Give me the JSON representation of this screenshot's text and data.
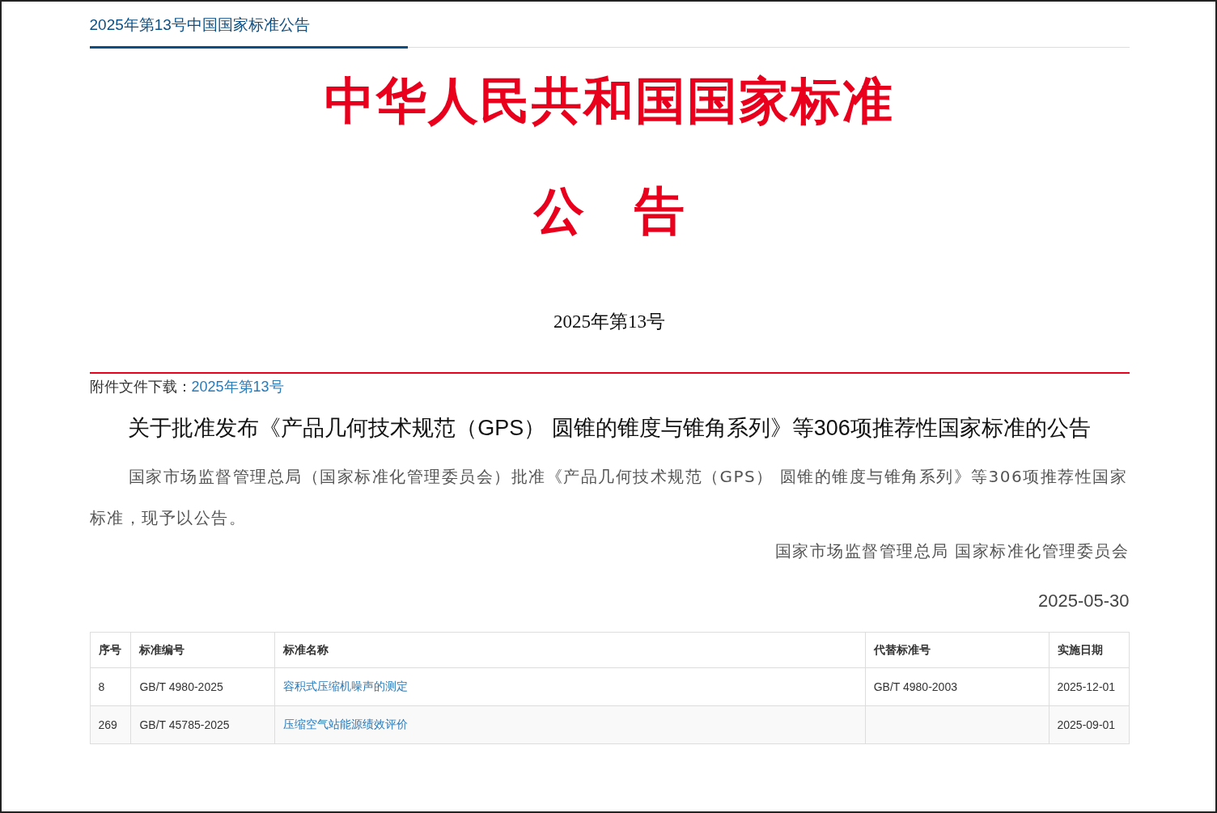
{
  "header": {
    "title": "2025年第13号中国国家标准公告"
  },
  "masthead": {
    "title": "中华人民共和国国家标准",
    "subtitle": "公　告",
    "number": "2025年第13号"
  },
  "attachment": {
    "label": "附件文件下载：",
    "link": "2025年第13号"
  },
  "article": {
    "title": "关于批准发布《产品几何技术规范（GPS） 圆锥的锥度与锥角系列》等306项推荐性国家标准的公告",
    "body": "国家市场监督管理总局（国家标准化管理委员会）批准《产品几何技术规范（GPS） 圆锥的锥度与锥角系列》等306项推荐性国家标准，现予以公告。",
    "issuer": "国家市场监督管理总局 国家标准化管理委员会",
    "date": "2025-05-30"
  },
  "table": {
    "columns": [
      "序号",
      "标准编号",
      "标准名称",
      "代替标准号",
      "实施日期"
    ],
    "rows": [
      {
        "index": "8",
        "code": "GB/T 4980-2025",
        "name": "容积式压缩机噪声的测定",
        "replaces": "GB/T 4980-2003",
        "effective": "2025-12-01"
      },
      {
        "index": "269",
        "code": "GB/T 45785-2025",
        "name": "压缩空气站能源绩效评价",
        "effective": "2025-09-01"
      }
    ]
  }
}
